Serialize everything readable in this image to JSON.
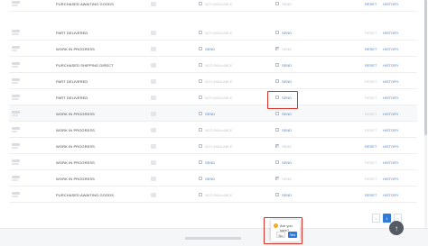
{
  "rows": [
    {
      "status": "PURCHASED AWAITING GOODS",
      "col3_checked": false,
      "col3_text": "NOT AVAILABLE",
      "col3_link": false,
      "col4_checked": false,
      "col4_text": "SEND",
      "col4_link": false,
      "reset": "RESET",
      "reset_active": true,
      "history": "HISTORY"
    },
    {
      "status": "PART DELIVERED",
      "col3_checked": false,
      "col3_text": "NOT AVAILABLE",
      "col3_link": false,
      "col4_checked": false,
      "col4_text": "SEND",
      "col4_link": true,
      "reset": "RESET",
      "reset_active": false,
      "history": "HISTORY"
    },
    {
      "status": "WORK IN PROGRESS",
      "col3_checked": false,
      "col3_text": "SEND",
      "col3_link": true,
      "col4_checked": true,
      "col4_text": "SEND",
      "col4_link": false,
      "reset": "RESET",
      "reset_active": true,
      "history": "HISTORY"
    },
    {
      "status": "PURCHASED SHIPPING DIRECT",
      "col3_checked": false,
      "col3_text": "NOT AVAILABLE",
      "col3_link": false,
      "col4_checked": false,
      "col4_text": "SEND",
      "col4_link": true,
      "reset": "RESET",
      "reset_active": true,
      "history": "HISTORY"
    },
    {
      "status": "PART DELIVERED",
      "col3_checked": false,
      "col3_text": "NOT AVAILABLE",
      "col3_link": false,
      "col4_checked": false,
      "col4_text": "SEND",
      "col4_link": true,
      "reset": "RESET",
      "reset_active": false,
      "history": "HISTORY"
    },
    {
      "status": "PART DELIVERED",
      "col3_checked": false,
      "col3_text": "NOT AVAILABLE",
      "col3_link": false,
      "col4_checked": false,
      "col4_text": "SEND",
      "col4_link": true,
      "reset": "RESET",
      "reset_active": false,
      "history": "HISTORY"
    },
    {
      "status": "WORK IN PROGRESS",
      "col3_checked": false,
      "col3_text": "SEND",
      "col3_link": true,
      "col4_checked": false,
      "col4_text": "SEND",
      "col4_link": true,
      "reset": "RESET",
      "reset_active": false,
      "history": "HISTORY"
    },
    {
      "status": "WORK IN PROGRESS",
      "col3_checked": false,
      "col3_text": "NOT AVAILABLE",
      "col3_link": false,
      "col4_checked": false,
      "col4_text": "SEND",
      "col4_link": true,
      "reset": "RESET",
      "reset_active": false,
      "history": "HISTORY"
    },
    {
      "status": "WORK IN PROGRESS",
      "col3_checked": false,
      "col3_text": "NOT AVAILABLE",
      "col3_link": false,
      "col4_checked": true,
      "col4_text": "SEND",
      "col4_link": false,
      "reset": "RESET",
      "reset_active": true,
      "history": "HISTORY"
    },
    {
      "status": "WORK IN PROGRESS",
      "col3_checked": false,
      "col3_text": "SEND",
      "col3_link": true,
      "col4_checked": false,
      "col4_text": "SEND",
      "col4_link": true,
      "reset": "RESET",
      "reset_active": false,
      "history": "HISTORY"
    },
    {
      "status": "WORK IN PROGRESS",
      "col3_checked": false,
      "col3_text": "SEND",
      "col3_link": true,
      "col4_checked": true,
      "col4_text": "SEND",
      "col4_link": false,
      "reset": "RESET",
      "reset_active": false,
      "history": "HISTORY"
    },
    {
      "status": "PURCHASED AWAITING GOODS",
      "col3_checked": false,
      "col3_text": "NOT AVAILABLE",
      "col3_link": false,
      "col4_checked": false,
      "col4_text": "SEND",
      "col4_link": true,
      "reset": "RESET",
      "reset_active": true,
      "history": "HISTORY"
    }
  ],
  "highlighted_row_index": 6,
  "pagination": {
    "prev": "<",
    "current": "1",
    "next": ">"
  },
  "popconfirm": {
    "icon": "!",
    "title": "Are you sure?",
    "no": "No",
    "yes": "Yes"
  },
  "scroll_top_icon": "↑",
  "colors": {
    "link": "#4a86c8",
    "primary": "#2f7ad8",
    "highlight": "#d8332a",
    "warning": "#f5a623"
  }
}
